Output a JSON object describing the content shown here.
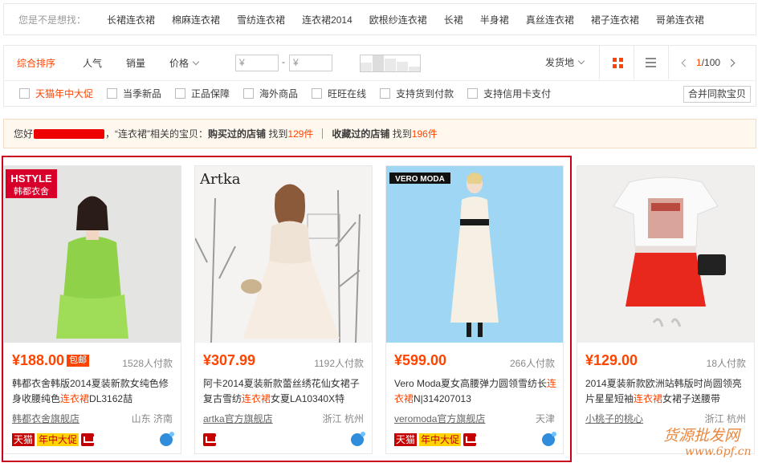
{
  "suggest": {
    "label": "您是不是想找：",
    "words": [
      "长裙连衣裙",
      "棉麻连衣裙",
      "雪纺连衣裙",
      "连衣裙2014",
      "欧根纱连衣裙",
      "长裙",
      "半身裙",
      "真丝连衣裙",
      "裙子连衣裙",
      "哥弟连衣裙"
    ]
  },
  "sort": {
    "tabs": [
      "综合排序",
      "人气",
      "销量",
      "价格"
    ],
    "price_min_placeholder": "¥",
    "price_max_placeholder": "¥",
    "dash": "-",
    "location_label": "发货地",
    "page_current": "1",
    "page_total": "/100"
  },
  "filters": {
    "items": [
      "天猫年中大促",
      "当季新品",
      "正品保障",
      "海外商品",
      "旺旺在线",
      "支持货到付款",
      "支持信用卡支付"
    ],
    "merge_label": "合并同款宝贝"
  },
  "tip": {
    "prefix": "您好",
    "mid": "，“连衣裙”相关的宝贝：",
    "bought_label": "购买过的店铺",
    "found1": "找到",
    "count1": "129件",
    "fav_label": "收藏过的店铺",
    "found2": "找到",
    "count2": "196件"
  },
  "products": [
    {
      "brand": "HSTYLE 韩都衣舍",
      "price": "¥188.00",
      "badge": "包邮",
      "deals": "1528人付款",
      "title_a": "韩都衣舍韩版2014夏装新款女纯色修身收腰纯色",
      "title_hl": "连衣裙",
      "title_b": "DL3162喆",
      "shop": "韩都衣舍旗舰店",
      "city": "山东 济南",
      "tmall": "天猫",
      "promo": "年中大促"
    },
    {
      "brand": "Artka",
      "price": "¥307.99",
      "badge": "",
      "deals": "1192人付款",
      "title_a": "阿卡2014夏装新款蕾丝绣花仙女裙子复古雪纺",
      "title_hl": "连衣裙",
      "title_b": "女夏LA10340X特",
      "shop": "artka官方旗舰店",
      "city": "浙江 杭州",
      "tmall": "",
      "promo": ""
    },
    {
      "brand": "VERO MODA",
      "price": "¥599.00",
      "badge": "",
      "deals": "266人付款",
      "title_a": "Vero Moda夏女高腰弹力圆领雪纺长",
      "title_hl": "连衣裙",
      "title_b": "N|314207013",
      "shop": "veromoda官方旗舰店",
      "city": "天津",
      "tmall": "天猫",
      "promo": "年中大促"
    },
    {
      "brand": "",
      "price": "¥129.00",
      "badge": "",
      "deals": "18人付款",
      "title_a": "2014夏装新款欧洲站韩版时尚圆领亮片星星短袖",
      "title_hl": "连衣裙",
      "title_b": "女裙子送腰带",
      "shop": "小桃子的桃心",
      "city": "浙江 杭州",
      "tmall": "",
      "promo": ""
    }
  ],
  "watermark": {
    "line1": "货源批发网",
    "line2": "www.6pf.cn"
  },
  "colors": {
    "accent": "#ff4400",
    "tmall_red": "#c40000",
    "highlight_border": "#c8001b"
  }
}
